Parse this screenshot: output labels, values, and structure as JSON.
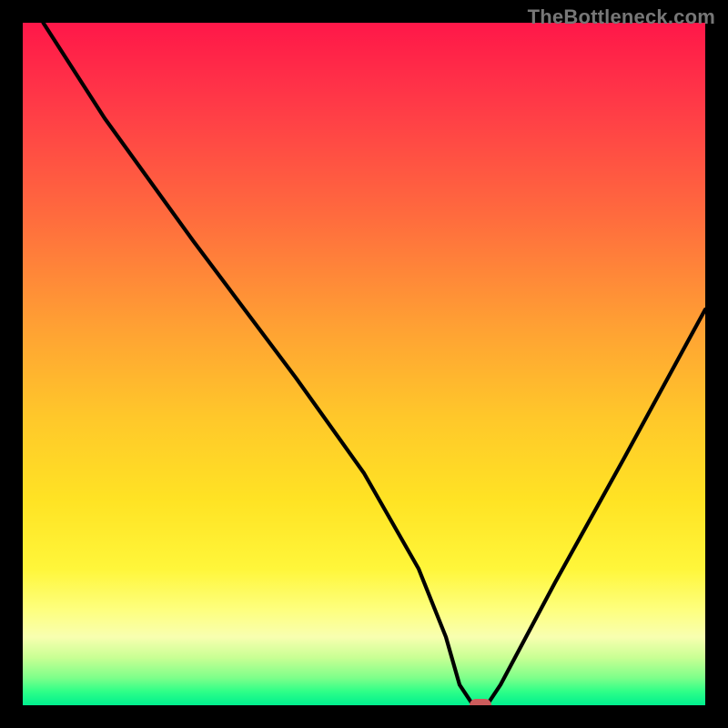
{
  "watermark": "TheBottleneck.com",
  "colors": {
    "frame": "#000000",
    "marker": "#cc5c5c",
    "curve": "#000000"
  },
  "chart_data": {
    "type": "line",
    "title": "",
    "xlabel": "",
    "ylabel": "",
    "xlim": [
      0,
      100
    ],
    "ylim": [
      0,
      100
    ],
    "grid": false,
    "legend": false,
    "series": [
      {
        "name": "bottleneck-curve",
        "x": [
          3,
          12,
          25,
          40,
          50,
          58,
          62,
          64,
          66,
          68,
          70,
          78,
          88,
          100
        ],
        "y": [
          100,
          86,
          68,
          48,
          34,
          20,
          10,
          3,
          0,
          0,
          3,
          18,
          36,
          58
        ]
      }
    ],
    "marker": {
      "x": 67,
      "y": 0
    }
  }
}
